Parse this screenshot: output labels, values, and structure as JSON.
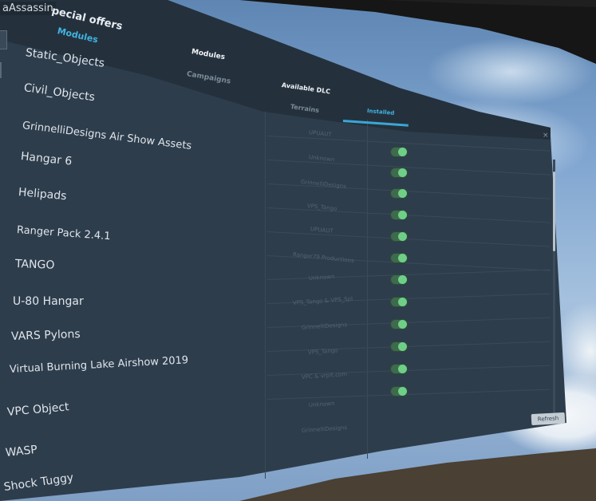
{
  "user": {
    "name": "aAssassin"
  },
  "header": {
    "title": "pecial offers"
  },
  "tabs_left": [
    {
      "label": "Modules",
      "active": true
    }
  ],
  "tabs_middle": [
    {
      "label": "Modules",
      "active": true
    },
    {
      "label": "Campaigns",
      "active": false
    }
  ],
  "tabs_right": [
    {
      "label": "Available DLC",
      "active": true
    },
    {
      "label": "Terrains",
      "active": false
    },
    {
      "label": "Installed",
      "active": true
    }
  ],
  "mods": [
    {
      "name": "Static_Objects",
      "author": "",
      "enabled": null
    },
    {
      "name": "Civil_Objects",
      "author": "UPUAUT",
      "enabled": null
    },
    {
      "name": "GrinnelliDesigns Air Show Assets",
      "author": "Unknown",
      "enabled": true
    },
    {
      "name": "Hangar 6",
      "author": "GrinnelliDesigns",
      "enabled": true
    },
    {
      "name": "Helipads",
      "author": "VPS_Tango",
      "enabled": true
    },
    {
      "name": "Ranger Pack 2.4.1",
      "author": "UPUAUT",
      "enabled": true
    },
    {
      "name": "TANGO",
      "author": "Ranger79 Productions",
      "enabled": true
    },
    {
      "name": "U-80 Hangar",
      "author": "Unknown",
      "enabled": true
    },
    {
      "name": "VARS Pylons",
      "author": "VPS_Tango & VPS_Spl",
      "enabled": true
    },
    {
      "name": "Virtual Burning Lake Airshow 2019",
      "author": "GrinnelliDesigns",
      "enabled": true
    },
    {
      "name": "VPC Object",
      "author": "VPS_Tango",
      "enabled": true
    },
    {
      "name": "WASP",
      "author": "VPC & vrpit.com",
      "enabled": true
    },
    {
      "name": "Shock Tuggy",
      "author": "Unknown",
      "enabled": true
    },
    {
      "name": "",
      "author": "GrinnelliDesigns",
      "enabled": true
    }
  ],
  "buttons": {
    "refresh": "Refresh",
    "close": "×"
  },
  "colors": {
    "accent": "#41b4e0",
    "toggle_on": "#6fcf88",
    "panel": "#2e3d4c"
  },
  "icons": {
    "close": "close-icon"
  }
}
